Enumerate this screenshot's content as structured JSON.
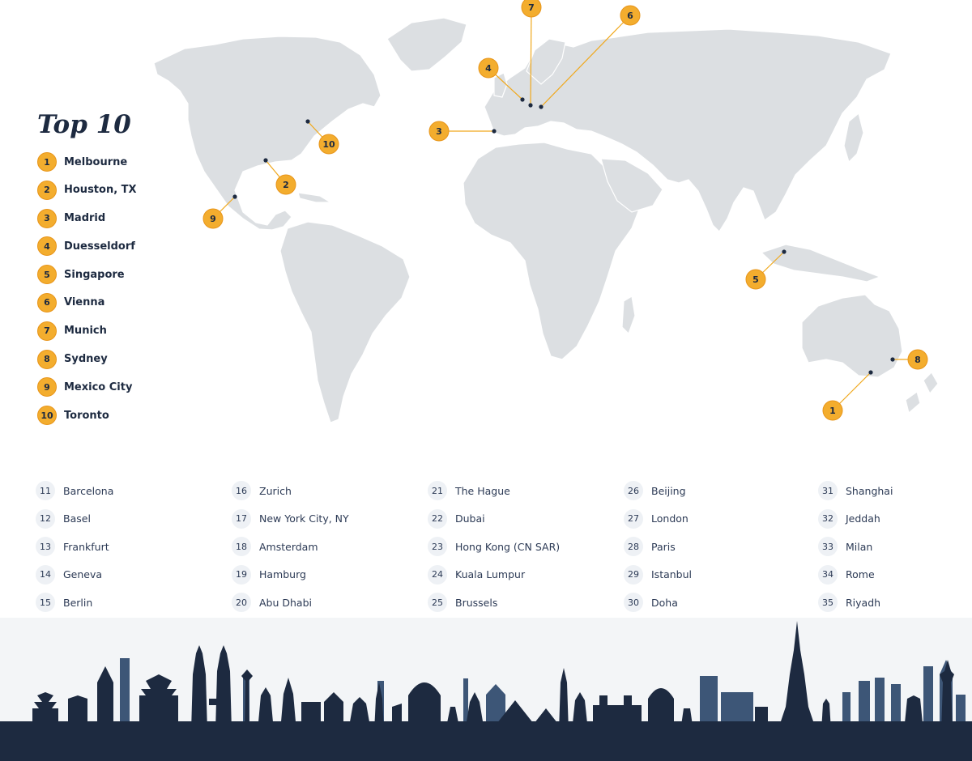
{
  "legend": {
    "title": "Top 10",
    "items": [
      {
        "rank": "1",
        "name": "Melbourne"
      },
      {
        "rank": "2",
        "name": "Houston, TX"
      },
      {
        "rank": "3",
        "name": "Madrid"
      },
      {
        "rank": "4",
        "name": "Duesseldorf"
      },
      {
        "rank": "5",
        "name": "Singapore"
      },
      {
        "rank": "6",
        "name": "Vienna"
      },
      {
        "rank": "7",
        "name": "Munich"
      },
      {
        "rank": "8",
        "name": "Sydney"
      },
      {
        "rank": "9",
        "name": "Mexico City"
      },
      {
        "rank": "10",
        "name": "Toronto"
      }
    ]
  },
  "markers": [
    {
      "rank": "1",
      "city": "Melbourne"
    },
    {
      "rank": "2",
      "city": "Houston, TX"
    },
    {
      "rank": "3",
      "city": "Madrid"
    },
    {
      "rank": "4",
      "city": "Duesseldorf"
    },
    {
      "rank": "5",
      "city": "Singapore"
    },
    {
      "rank": "6",
      "city": "Vienna"
    },
    {
      "rank": "7",
      "city": "Munich"
    },
    {
      "rank": "8",
      "city": "Sydney"
    },
    {
      "rank": "9",
      "city": "Mexico City"
    },
    {
      "rank": "10",
      "city": "Toronto"
    }
  ],
  "rankings": [
    [
      {
        "rank": "11",
        "name": "Barcelona"
      },
      {
        "rank": "12",
        "name": "Basel"
      },
      {
        "rank": "13",
        "name": "Frankfurt"
      },
      {
        "rank": "14",
        "name": "Geneva"
      },
      {
        "rank": "15",
        "name": "Berlin"
      }
    ],
    [
      {
        "rank": "16",
        "name": "Zurich"
      },
      {
        "rank": "17",
        "name": "New York City, NY"
      },
      {
        "rank": "18",
        "name": "Amsterdam"
      },
      {
        "rank": "19",
        "name": "Hamburg"
      },
      {
        "rank": "20",
        "name": "Abu Dhabi"
      }
    ],
    [
      {
        "rank": "21",
        "name": "The Hague"
      },
      {
        "rank": "22",
        "name": "Dubai"
      },
      {
        "rank": "23",
        "name": "Hong Kong (CN SAR)"
      },
      {
        "rank": "24",
        "name": "Kuala Lumpur"
      },
      {
        "rank": "25",
        "name": "Brussels"
      }
    ],
    [
      {
        "rank": "26",
        "name": "Beijing"
      },
      {
        "rank": "27",
        "name": "London"
      },
      {
        "rank": "28",
        "name": "Paris"
      },
      {
        "rank": "29",
        "name": "Istanbul"
      },
      {
        "rank": "30",
        "name": "Doha"
      }
    ],
    [
      {
        "rank": "31",
        "name": "Shanghai"
      },
      {
        "rank": "32",
        "name": "Jeddah"
      },
      {
        "rank": "33",
        "name": "Milan"
      },
      {
        "rank": "34",
        "name": "Rome"
      },
      {
        "rank": "35",
        "name": "Riyadh"
      }
    ]
  ],
  "colors": {
    "land": "#dcdfe2",
    "accent": "#f3ad2e",
    "navy": "#1d2a40",
    "skyline_light": "#3d5677"
  }
}
